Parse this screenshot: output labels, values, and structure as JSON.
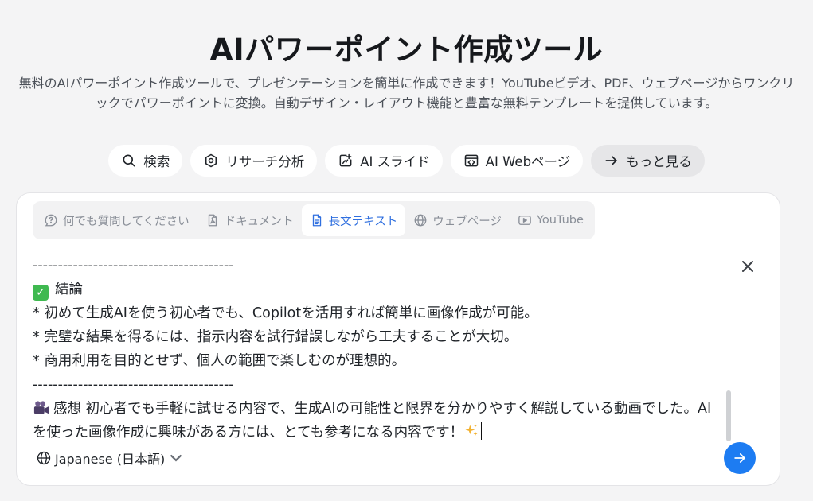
{
  "header": {
    "title": "AIパワーポイント作成ツール",
    "subtitle": "無料のAIパワーポイント作成ツールで、プレゼンテーションを簡単に作成できます！YouTubeビデオ、PDF、ウェブページからワンクリックでパワーポイントに変換。自動デザイン・レイアウト機能と豊富な無料テンプレートを提供しています。"
  },
  "chips": [
    {
      "label": "検索",
      "icon": "search-icon"
    },
    {
      "label": "リサーチ分析",
      "icon": "research-icon"
    },
    {
      "label": "AI スライド",
      "icon": "slide-edit-icon"
    },
    {
      "label": "AI Webページ",
      "icon": "code-window-icon"
    },
    {
      "label": "もっと見る",
      "icon": "arrow-right-icon"
    }
  ],
  "tabs": [
    {
      "label": "何でも質問してください",
      "icon": "question-bubble-icon",
      "active": false
    },
    {
      "label": "ドキュメント",
      "icon": "pdf-file-icon",
      "active": false
    },
    {
      "label": "長文テキスト",
      "icon": "text-file-icon",
      "active": true
    },
    {
      "label": "ウェブページ",
      "icon": "globe-icon",
      "active": false
    },
    {
      "label": "YouTube",
      "icon": "youtube-icon",
      "active": false
    }
  ],
  "editor": {
    "lines": [
      "----------------------------------------",
      "結論",
      "* 初めて生成AIを使う初心者でも、Copilotを活用すれば簡単に画像作成が可能。",
      "* 完璧な結果を得るには、指示内容を試行錯誤しながら工夫することが大切。",
      "* 商用利用を目的とせず、個人の範囲で楽しむのが理想的。",
      "----------------------------------------",
      "感想 初心者でも手軽に試せる内容で、生成AIの可能性と限界を分かりやすく解説している動画でした。AIを使った画像作成に興味がある方には、とても参考になる内容です！"
    ],
    "emoji": {
      "conclusion": "check-mark-emoji",
      "impression": "movie-camera-emoji",
      "end": "sparkles-emoji"
    }
  },
  "language": {
    "label": "Japanese (日本語)",
    "icon": "globe-icon"
  },
  "colors": {
    "accent": "#1d7cf2",
    "active_tab": "#2f6fdf",
    "background": "#f4f4f5"
  }
}
